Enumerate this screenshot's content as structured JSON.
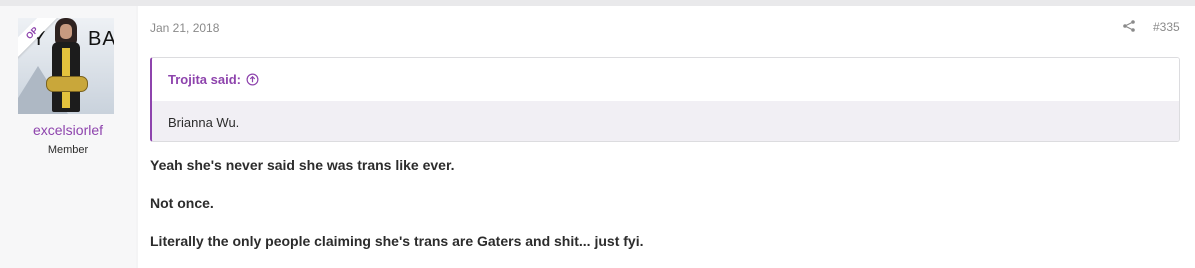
{
  "author": {
    "username": "excelsiorlef",
    "title": "Member",
    "op_badge": "OP",
    "avatar_text_left": "Y",
    "avatar_text_right": "BAY"
  },
  "post": {
    "date": "Jan 21, 2018",
    "number": "#335",
    "share_icon": "share-icon",
    "quote": {
      "attribution": "Trojita said:",
      "arrow_icon": "arrow-up-circle-icon",
      "text": "Brianna Wu."
    },
    "paragraphs": [
      "Yeah she's never said she was trans like ever.",
      "Not once.",
      "Literally the only people claiming she's trans are Gaters and shit... just fyi."
    ]
  },
  "colors": {
    "accent": "#8e44ad",
    "quote_bg": "#f1eff4",
    "page_bg": "#f4f4f5"
  }
}
